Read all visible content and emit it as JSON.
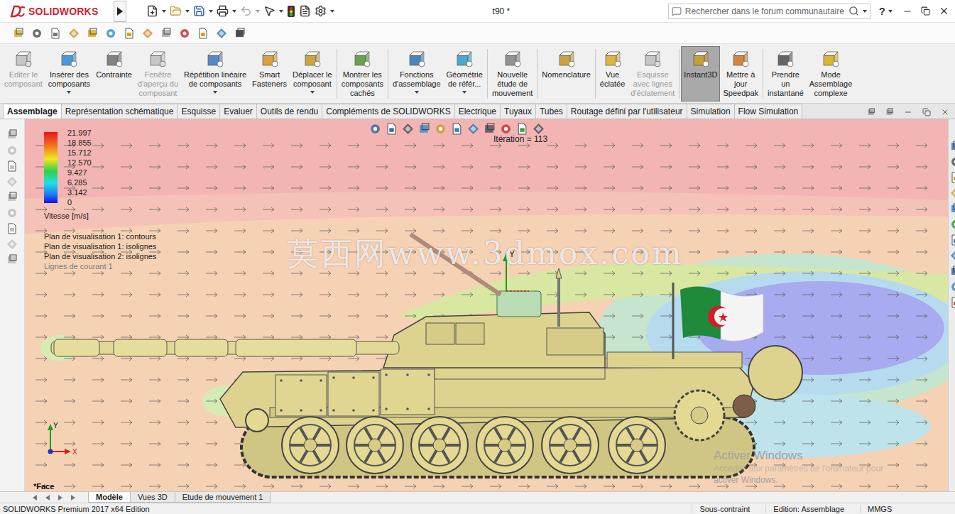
{
  "app": {
    "logo": "SOLIDWORKS",
    "title": "t90 *",
    "search_placeholder": "Rechercher dans le forum communautaire",
    "help": "?"
  },
  "command_buttons": [
    {
      "lines": [
        "Editer le",
        "composant"
      ],
      "disabled": true,
      "selected": false,
      "dropdown": false,
      "separator_before": false
    },
    {
      "lines": [
        "Insérer des",
        "composants"
      ],
      "disabled": false,
      "selected": false,
      "dropdown": true,
      "separator_before": false
    },
    {
      "lines": [
        "Contrainte"
      ],
      "disabled": false,
      "selected": false,
      "dropdown": false,
      "separator_before": false
    },
    {
      "lines": [
        "Fenêtre",
        "d'aperçu du",
        "composant"
      ],
      "disabled": true,
      "selected": false,
      "dropdown": false,
      "separator_before": false
    },
    {
      "lines": [
        "Répétition linéaire",
        "de composants"
      ],
      "disabled": false,
      "selected": false,
      "dropdown": true,
      "separator_before": false
    },
    {
      "lines": [
        "Smart",
        "Fasteners"
      ],
      "disabled": false,
      "selected": false,
      "dropdown": false,
      "separator_before": false
    },
    {
      "lines": [
        "Déplacer le",
        "composant"
      ],
      "disabled": false,
      "selected": false,
      "dropdown": true,
      "separator_before": false
    },
    {
      "lines": [
        "Montrer les",
        "composants",
        "cachés"
      ],
      "disabled": false,
      "selected": false,
      "dropdown": false,
      "separator_before": true
    },
    {
      "lines": [
        "Fonctions",
        "d'assemblage"
      ],
      "disabled": false,
      "selected": false,
      "dropdown": true,
      "separator_before": true
    },
    {
      "lines": [
        "Géométrie",
        "de référ..."
      ],
      "disabled": false,
      "selected": false,
      "dropdown": true,
      "separator_before": false
    },
    {
      "lines": [
        "Nouvelle",
        "étude de",
        "mouvement"
      ],
      "disabled": false,
      "selected": false,
      "dropdown": false,
      "separator_before": true
    },
    {
      "lines": [
        "Nomenclature"
      ],
      "disabled": false,
      "selected": false,
      "dropdown": false,
      "separator_before": true
    },
    {
      "lines": [
        "Vue",
        "éclatée"
      ],
      "disabled": false,
      "selected": false,
      "dropdown": false,
      "separator_before": true
    },
    {
      "lines": [
        "Esquisse",
        "avec lignes",
        "d'éclatement"
      ],
      "disabled": true,
      "selected": false,
      "dropdown": false,
      "separator_before": false
    },
    {
      "lines": [
        "Instant3D"
      ],
      "disabled": false,
      "selected": true,
      "dropdown": false,
      "separator_before": true
    },
    {
      "lines": [
        "Mettre à",
        "jour",
        "Speedpak"
      ],
      "disabled": false,
      "selected": false,
      "dropdown": false,
      "separator_before": false
    },
    {
      "lines": [
        "Prendre",
        "un",
        "instantané"
      ],
      "disabled": false,
      "selected": false,
      "dropdown": false,
      "separator_before": true
    },
    {
      "lines": [
        "Mode",
        "Assemblage",
        "complexe"
      ],
      "disabled": false,
      "selected": false,
      "dropdown": false,
      "separator_before": false
    }
  ],
  "tabs": [
    {
      "label": "Assemblage",
      "selected": true
    },
    {
      "label": "Représentation schématique",
      "selected": false
    },
    {
      "label": "Esquisse",
      "selected": false
    },
    {
      "label": "Evaluer",
      "selected": false
    },
    {
      "label": "Outils de rendu",
      "selected": false
    },
    {
      "label": "Compléments de SOLIDWORKS",
      "selected": false
    },
    {
      "label": "Electrique",
      "selected": false
    },
    {
      "label": "Tuyaux",
      "selected": false
    },
    {
      "label": "Tubes",
      "selected": false
    },
    {
      "label": "Routage défini par l'utilisateur",
      "selected": false
    },
    {
      "label": "Simulation",
      "selected": false
    },
    {
      "label": "Flow Simulation",
      "selected": false
    }
  ],
  "graphics": {
    "iteration": "Itération = 113",
    "legend": {
      "values": [
        "21.997",
        "18.855",
        "15.712",
        "12.570",
        "9.427",
        "6.285",
        "3.142",
        "0"
      ],
      "unit": "Vitesse [m/s]"
    },
    "plots": [
      {
        "label": "Plan de visualisation 1: contours",
        "disabled": false
      },
      {
        "label": "Plan de visualisation 1: isolignes",
        "disabled": false
      },
      {
        "label": "Plan de visualisation 2: isolignes",
        "disabled": false
      },
      {
        "label": "Lignes de courant 1",
        "disabled": true
      }
    ],
    "watermark": "莫西网www.3dmox.com",
    "activation": [
      "Activer Windows",
      "Accédez aux paramètres de l'ordinateur pour",
      "activer Windows."
    ],
    "selection": "*Face",
    "model_triad": {
      "y": "Y"
    },
    "view_triad": {
      "y": "Y",
      "x": "X"
    }
  },
  "bottom_tabs": [
    {
      "label": "Modèle",
      "selected": true
    },
    {
      "label": "Vues 3D",
      "selected": false
    },
    {
      "label": "Etude de mouvement 1",
      "selected": false
    }
  ],
  "status_bar": {
    "product": "SOLIDWORKS Premium 2017 x64 Edition",
    "items": [
      "Sous-contraint",
      "Edition: Assemblage",
      "MMGS"
    ]
  }
}
